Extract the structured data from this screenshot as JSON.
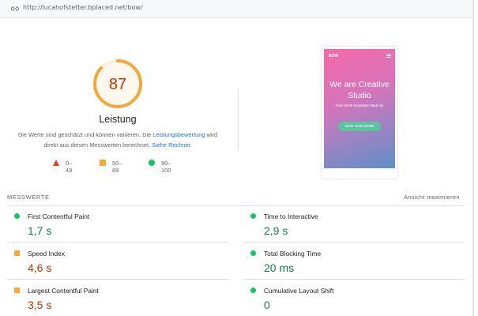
{
  "url_bar": {
    "url": "http://lucahofstetter.bplaced.net/bow/",
    "icon": "link-icon"
  },
  "gauge": {
    "score": "87",
    "score_fraction": 0.87,
    "label": "Leistung",
    "color": "#f4a73a",
    "text_color": "#c33300"
  },
  "description": {
    "part1": "Die Werte sind geschätzt und können variieren. Die ",
    "link1": "Leistungsbewertung",
    "part2": " wird direkt aus diesen Messwerten berechnet. ",
    "link2": "Siehe Rechner."
  },
  "legend": [
    {
      "range": "0–49",
      "shape": "triangle",
      "color": "#eb3b27"
    },
    {
      "range": "50–89",
      "shape": "square",
      "color": "#f4a73a"
    },
    {
      "range": "90–100",
      "shape": "circle",
      "color": "#13c760"
    }
  ],
  "preview": {
    "brand": "BOW",
    "title": "We are Creative Studio",
    "subtitle": "Free html5 templates Made by",
    "button": "VIEW OUR WORK"
  },
  "metrics": {
    "title": "MESSWERTE",
    "expand_label": "Ansicht maximieren",
    "items": [
      {
        "name": "First Contentful Paint",
        "value": "1,7 s",
        "rating": "good"
      },
      {
        "name": "Time to Interactive",
        "value": "2,9 s",
        "rating": "good"
      },
      {
        "name": "Speed Index",
        "value": "4,6 s",
        "rating": "average"
      },
      {
        "name": "Total Blocking Time",
        "value": "20 ms",
        "rating": "good"
      },
      {
        "name": "Largest Contentful Paint",
        "value": "3,5 s",
        "rating": "average"
      },
      {
        "name": "Cumulative Layout Shift",
        "value": "0",
        "rating": "good"
      }
    ]
  }
}
